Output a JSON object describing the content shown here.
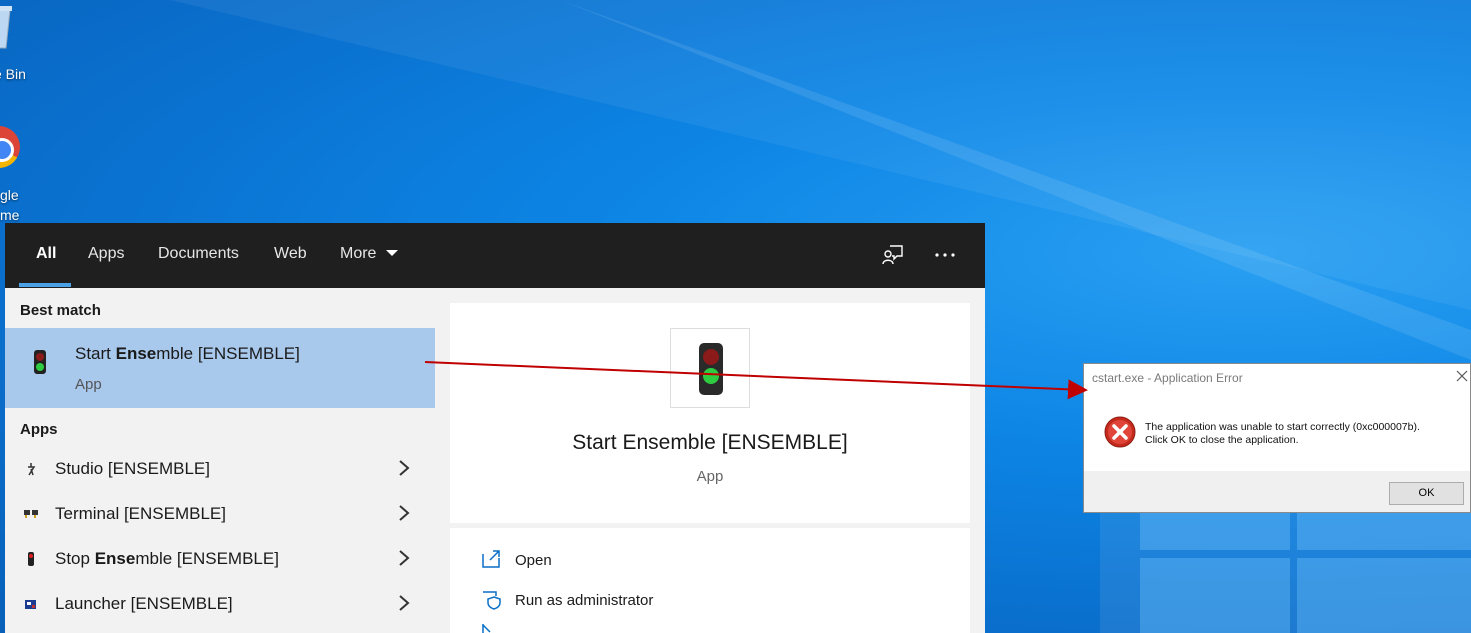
{
  "desktop": {
    "icons": [
      {
        "name": "recycle-bin",
        "label": "e Bin"
      },
      {
        "name": "google-chrome",
        "label_line1": "gle",
        "label_line2": "me"
      }
    ]
  },
  "search": {
    "tabs": [
      "All",
      "Apps",
      "Documents",
      "Web",
      "More"
    ],
    "active_tab": "All",
    "best_match_heading": "Best match",
    "best_match": {
      "title_pre": "Start ",
      "title_bold": "Ense",
      "title_post": "mble [ENSEMBLE]",
      "subtitle": "App"
    },
    "apps_heading": "Apps",
    "apps": [
      {
        "pre": "Studio [ENSEMBLE]",
        "bold": "",
        "post": ""
      },
      {
        "pre": "Terminal [ENSEMBLE]",
        "bold": "",
        "post": ""
      },
      {
        "pre": "Stop ",
        "bold": "Ense",
        "post": "mble [ENSEMBLE]"
      },
      {
        "pre": "Launcher [ENSEMBLE]",
        "bold": "",
        "post": ""
      }
    ],
    "preview": {
      "title": "Start Ensemble [ENSEMBLE]",
      "subtitle": "App"
    },
    "actions": [
      "Open",
      "Run as administrator"
    ]
  },
  "error_dialog": {
    "title": "cstart.exe - Application Error",
    "message_line1": "The application was unable to start correctly (0xc000007b).",
    "message_line2": "Click OK to close the application.",
    "ok_label": "OK"
  },
  "colors": {
    "accent": "#4ca0e6",
    "selected_row": "#a8c8ec",
    "annotation_arrow": "#c00000"
  }
}
